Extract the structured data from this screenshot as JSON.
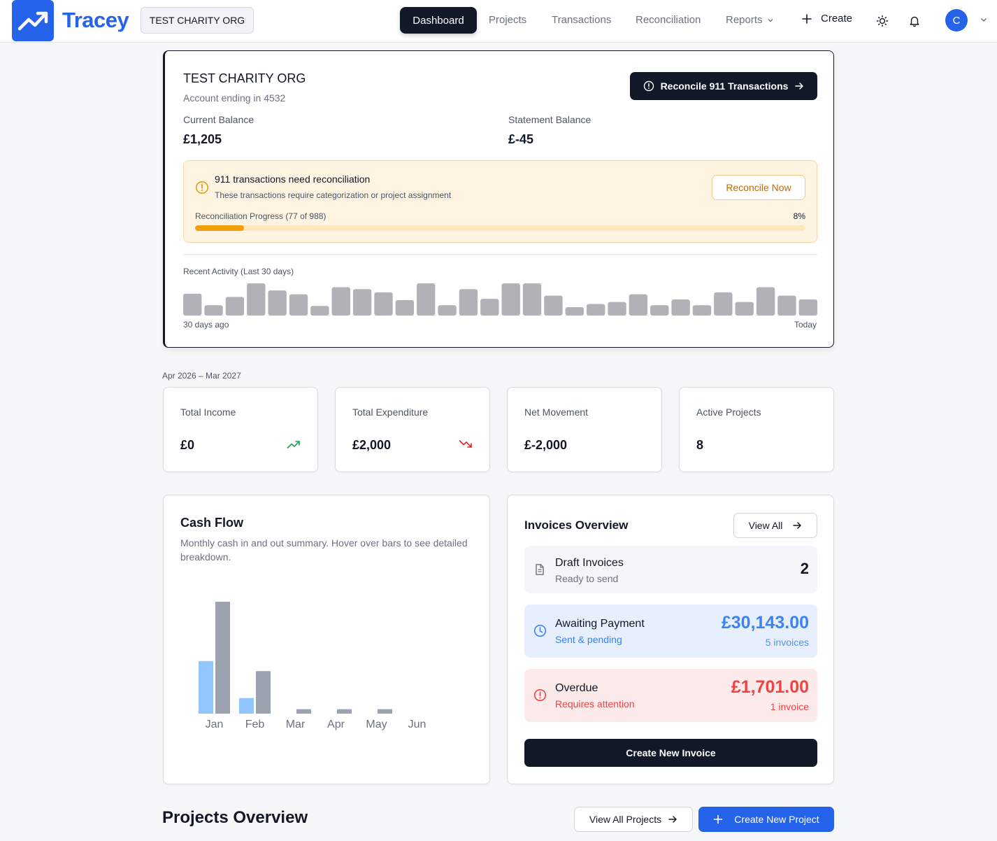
{
  "app": {
    "brand": "Tracey",
    "org_selector": "TEST CHARITY ORG"
  },
  "nav": {
    "dashboard": "Dashboard",
    "projects": "Projects",
    "transactions": "Transactions",
    "reconciliation": "Reconciliation",
    "reports": "Reports",
    "create": "Create",
    "avatar_initial": "C"
  },
  "account": {
    "name": "TEST CHARITY ORG",
    "subtitle": "Account ending in 4532",
    "reconcile_button": "Reconcile 911 Transactions",
    "current_balance_label": "Current Balance",
    "current_balance": "£1,205",
    "statement_balance_label": "Statement Balance",
    "statement_balance": "£-45"
  },
  "alert": {
    "title": "911 transactions need reconciliation",
    "description": "These transactions require categorization or project assignment",
    "action": "Reconcile Now",
    "progress_label": "Reconciliation Progress (77 of 988)",
    "progress_percent": "8%",
    "progress_value": 0.08,
    "colors": {
      "track": "#fde6bd",
      "fill": "#f59e0b"
    }
  },
  "activity": {
    "label": "Recent Activity (Last 30 days)",
    "start_label": "30 days ago",
    "end_label": "Today",
    "levels": [
      0.68,
      0.32,
      0.58,
      1.0,
      0.78,
      0.66,
      0.3,
      0.88,
      0.82,
      0.72,
      0.48,
      1.0,
      0.32,
      0.82,
      0.52,
      1.0,
      1.0,
      0.62,
      0.26,
      0.36,
      0.42,
      0.66,
      0.32,
      0.5,
      0.32,
      0.72,
      0.42,
      0.88,
      0.62,
      0.5
    ]
  },
  "period_label": "Apr 2026 – Mar 2027",
  "stats": [
    {
      "label": "Total Income",
      "value": "£0",
      "icon": "trending-up-icon",
      "icon_color": "#16a34a"
    },
    {
      "label": "Total Expenditure",
      "value": "£2,000",
      "icon": "trending-down-icon",
      "icon_color": "#dc2626"
    },
    {
      "label": "Net Movement",
      "value": "£-2,000"
    },
    {
      "label": "Active Projects",
      "value": "8"
    }
  ],
  "cash_flow": {
    "title": "Cash Flow",
    "description": "Monthly cash in and out summary. Hover over bars to see detailed breakdown."
  },
  "chart_data": {
    "type": "bar",
    "categories": [
      "Jan",
      "Feb",
      "Mar",
      "Apr",
      "May",
      "Jun"
    ],
    "series": [
      {
        "values": [
          470,
          140,
          0,
          0,
          0,
          0
        ],
        "color": "#93c5fd"
      },
      {
        "values": [
          1000,
          380,
          40,
          40,
          40,
          0
        ],
        "color": "#9ca3af"
      }
    ],
    "ylim": [
      0,
      1000
    ],
    "grid": false
  },
  "invoices": {
    "title": "Invoices Overview",
    "view_all": "View All",
    "draft": {
      "title": "Draft Invoices",
      "subtitle": "Ready to send",
      "value": "2"
    },
    "awaiting": {
      "title": "Awaiting Payment",
      "subtitle": "Sent & pending",
      "amount": "£30,143.00",
      "count": "5 invoices"
    },
    "overdue": {
      "title": "Overdue",
      "subtitle": "Requires attention",
      "amount": "£1,701.00",
      "count": "1 invoice"
    },
    "create_button": "Create New Invoice"
  },
  "projects_overview": {
    "title": "Projects Overview",
    "view_all": "View All Projects",
    "create": "Create New Project"
  },
  "colors": {
    "brand": "#2563eb",
    "dark": "#111827",
    "warning": "#f59e0b",
    "danger": "#ef4444"
  }
}
